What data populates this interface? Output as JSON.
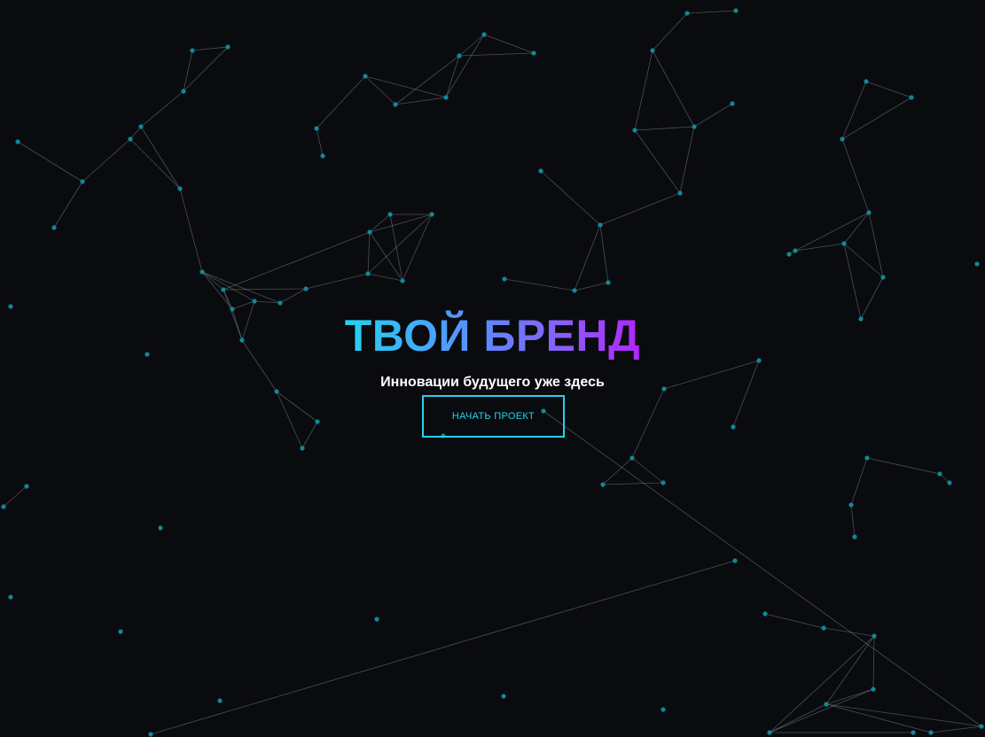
{
  "hero": {
    "title": "ТВОЙ БРЕНД",
    "tagline": "Инновации будущего уже здесь",
    "cta_label": "НАЧАТЬ ПРОЕКТ"
  },
  "background": {
    "kind": "particle-network",
    "color": "#0a0b0e",
    "node_color": "#0e8a96",
    "link_color": "#9aa0a8"
  },
  "colors": {
    "accent": "#22d3ee",
    "gradient_start": "#22d3ee",
    "gradient_mid": "#5b8cff",
    "gradient_end": "#b026ff",
    "text": "#ffffff"
  }
}
